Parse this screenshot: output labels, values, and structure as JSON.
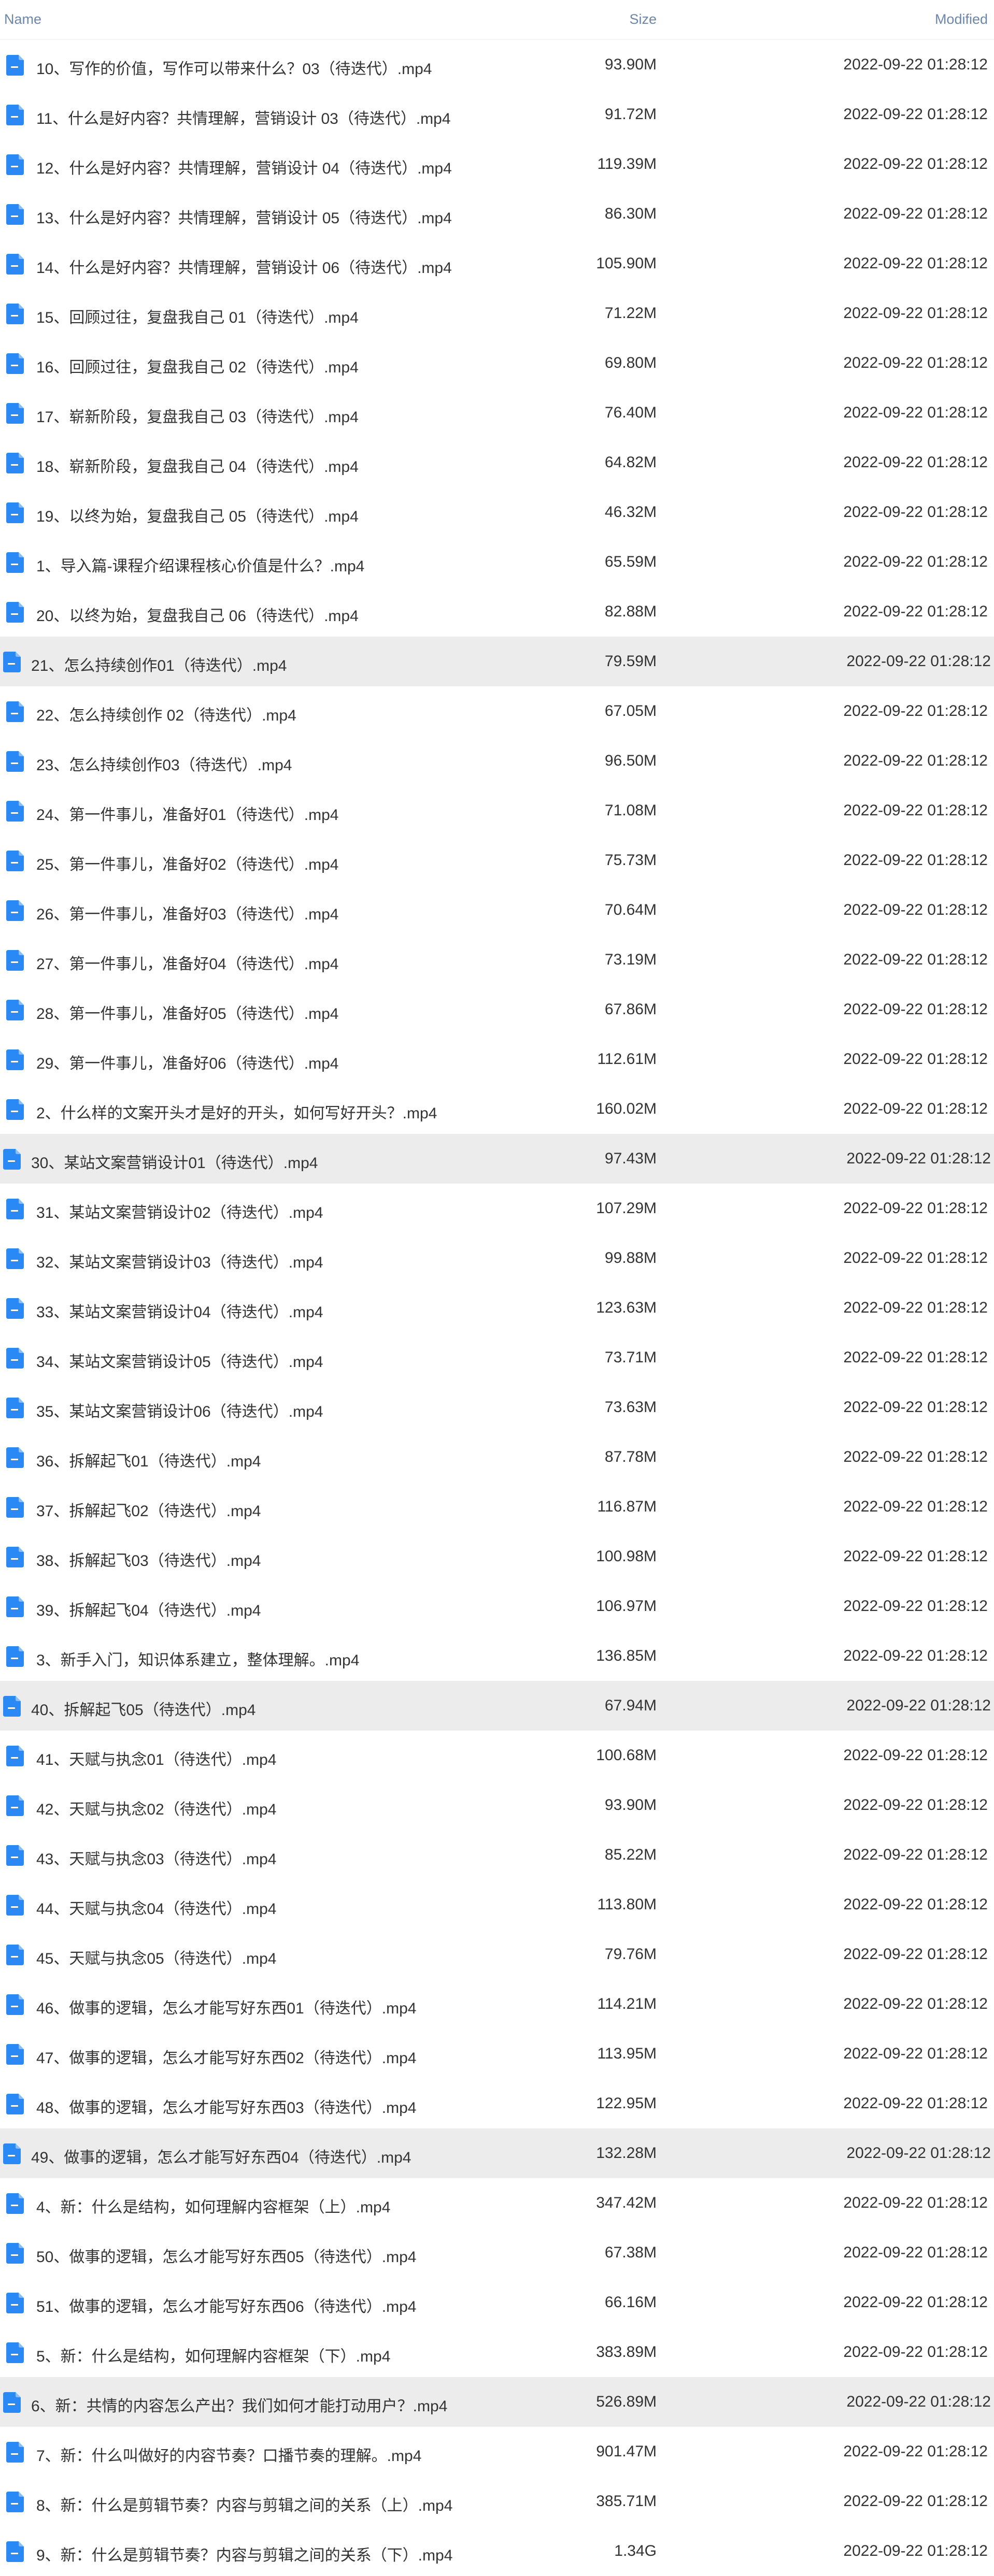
{
  "colors": {
    "accent": "#2a89f4",
    "header_text": "#6e87a8",
    "row_text": "#333333",
    "highlight_row": "#ececec"
  },
  "header": {
    "name": "Name",
    "size": "Size",
    "modified": "Modified"
  },
  "files": [
    {
      "name": "10、写作的价值，写作可以带来什么？03（待迭代）.mp4",
      "size": "93.90M",
      "modified": "2022-09-22 01:28:12",
      "highlighted": false
    },
    {
      "name": "11、什么是好内容？共情理解，营销设计 03（待迭代）.mp4",
      "size": "91.72M",
      "modified": "2022-09-22 01:28:12",
      "highlighted": false
    },
    {
      "name": "12、什么是好内容？共情理解，营销设计 04（待迭代）.mp4",
      "size": "119.39M",
      "modified": "2022-09-22 01:28:12",
      "highlighted": false
    },
    {
      "name": "13、什么是好内容？共情理解，营销设计 05（待迭代）.mp4",
      "size": "86.30M",
      "modified": "2022-09-22 01:28:12",
      "highlighted": false
    },
    {
      "name": "14、什么是好内容？共情理解，营销设计 06（待迭代）.mp4",
      "size": "105.90M",
      "modified": "2022-09-22 01:28:12",
      "highlighted": false
    },
    {
      "name": "15、回顾过往，复盘我自己 01（待迭代）.mp4",
      "size": "71.22M",
      "modified": "2022-09-22 01:28:12",
      "highlighted": false
    },
    {
      "name": "16、回顾过往，复盘我自己 02（待迭代）.mp4",
      "size": "69.80M",
      "modified": "2022-09-22 01:28:12",
      "highlighted": false
    },
    {
      "name": "17、崭新阶段，复盘我自己 03（待迭代）.mp4",
      "size": "76.40M",
      "modified": "2022-09-22 01:28:12",
      "highlighted": false
    },
    {
      "name": "18、崭新阶段，复盘我自己 04（待迭代）.mp4",
      "size": "64.82M",
      "modified": "2022-09-22 01:28:12",
      "highlighted": false
    },
    {
      "name": "19、以终为始，复盘我自己 05（待迭代）.mp4",
      "size": "46.32M",
      "modified": "2022-09-22 01:28:12",
      "highlighted": false
    },
    {
      "name": "1、导入篇-课程介绍课程核心价值是什么？.mp4",
      "size": "65.59M",
      "modified": "2022-09-22 01:28:12",
      "highlighted": false
    },
    {
      "name": "20、以终为始，复盘我自己 06（待迭代）.mp4",
      "size": "82.88M",
      "modified": "2022-09-22 01:28:12",
      "highlighted": false
    },
    {
      "name": "21、怎么持续创作01（待迭代）.mp4",
      "size": "79.59M",
      "modified": "2022-09-22 01:28:12",
      "highlighted": true
    },
    {
      "name": "22、怎么持续创作 02（待迭代）.mp4",
      "size": "67.05M",
      "modified": "2022-09-22 01:28:12",
      "highlighted": false
    },
    {
      "name": "23、怎么持续创作03（待迭代）.mp4",
      "size": "96.50M",
      "modified": "2022-09-22 01:28:12",
      "highlighted": false
    },
    {
      "name": "24、第一件事儿，准备好01（待迭代）.mp4",
      "size": "71.08M",
      "modified": "2022-09-22 01:28:12",
      "highlighted": false
    },
    {
      "name": "25、第一件事儿，准备好02（待迭代）.mp4",
      "size": "75.73M",
      "modified": "2022-09-22 01:28:12",
      "highlighted": false
    },
    {
      "name": "26、第一件事儿，准备好03（待迭代）.mp4",
      "size": "70.64M",
      "modified": "2022-09-22 01:28:12",
      "highlighted": false
    },
    {
      "name": "27、第一件事儿，准备好04（待迭代）.mp4",
      "size": "73.19M",
      "modified": "2022-09-22 01:28:12",
      "highlighted": false
    },
    {
      "name": "28、第一件事儿，准备好05（待迭代）.mp4",
      "size": "67.86M",
      "modified": "2022-09-22 01:28:12",
      "highlighted": false
    },
    {
      "name": "29、第一件事儿，准备好06（待迭代）.mp4",
      "size": "112.61M",
      "modified": "2022-09-22 01:28:12",
      "highlighted": false
    },
    {
      "name": "2、什么样的文案开头才是好的开头，如何写好开头？.mp4",
      "size": "160.02M",
      "modified": "2022-09-22 01:28:12",
      "highlighted": false
    },
    {
      "name": "30、某站文案营销设计01（待迭代）.mp4",
      "size": "97.43M",
      "modified": "2022-09-22 01:28:12",
      "highlighted": true
    },
    {
      "name": "31、某站文案营销设计02（待迭代）.mp4",
      "size": "107.29M",
      "modified": "2022-09-22 01:28:12",
      "highlighted": false
    },
    {
      "name": "32、某站文案营销设计03（待迭代）.mp4",
      "size": "99.88M",
      "modified": "2022-09-22 01:28:12",
      "highlighted": false
    },
    {
      "name": "33、某站文案营销设计04（待迭代）.mp4",
      "size": "123.63M",
      "modified": "2022-09-22 01:28:12",
      "highlighted": false
    },
    {
      "name": "34、某站文案营销设计05（待迭代）.mp4",
      "size": "73.71M",
      "modified": "2022-09-22 01:28:12",
      "highlighted": false
    },
    {
      "name": "35、某站文案营销设计06（待迭代）.mp4",
      "size": "73.63M",
      "modified": "2022-09-22 01:28:12",
      "highlighted": false
    },
    {
      "name": "36、拆解起飞01（待迭代）.mp4",
      "size": "87.78M",
      "modified": "2022-09-22 01:28:12",
      "highlighted": false
    },
    {
      "name": "37、拆解起飞02（待迭代）.mp4",
      "size": "116.87M",
      "modified": "2022-09-22 01:28:12",
      "highlighted": false
    },
    {
      "name": "38、拆解起飞03（待迭代）.mp4",
      "size": "100.98M",
      "modified": "2022-09-22 01:28:12",
      "highlighted": false
    },
    {
      "name": "39、拆解起飞04（待迭代）.mp4",
      "size": "106.97M",
      "modified": "2022-09-22 01:28:12",
      "highlighted": false
    },
    {
      "name": "3、新手入门，知识体系建立，整体理解。.mp4",
      "size": "136.85M",
      "modified": "2022-09-22 01:28:12",
      "highlighted": false
    },
    {
      "name": "40、拆解起飞05（待迭代）.mp4",
      "size": "67.94M",
      "modified": "2022-09-22 01:28:12",
      "highlighted": true
    },
    {
      "name": "41、天赋与执念01（待迭代）.mp4",
      "size": "100.68M",
      "modified": "2022-09-22 01:28:12",
      "highlighted": false
    },
    {
      "name": "42、天赋与执念02（待迭代）.mp4",
      "size": "93.90M",
      "modified": "2022-09-22 01:28:12",
      "highlighted": false
    },
    {
      "name": "43、天赋与执念03（待迭代）.mp4",
      "size": "85.22M",
      "modified": "2022-09-22 01:28:12",
      "highlighted": false
    },
    {
      "name": "44、天赋与执念04（待迭代）.mp4",
      "size": "113.80M",
      "modified": "2022-09-22 01:28:12",
      "highlighted": false
    },
    {
      "name": "45、天赋与执念05（待迭代）.mp4",
      "size": "79.76M",
      "modified": "2022-09-22 01:28:12",
      "highlighted": false
    },
    {
      "name": "46、做事的逻辑，怎么才能写好东西01（待迭代）.mp4",
      "size": "114.21M",
      "modified": "2022-09-22 01:28:12",
      "highlighted": false
    },
    {
      "name": "47、做事的逻辑，怎么才能写好东西02（待迭代）.mp4",
      "size": "113.95M",
      "modified": "2022-09-22 01:28:12",
      "highlighted": false
    },
    {
      "name": "48、做事的逻辑，怎么才能写好东西03（待迭代）.mp4",
      "size": "122.95M",
      "modified": "2022-09-22 01:28:12",
      "highlighted": false
    },
    {
      "name": "49、做事的逻辑，怎么才能写好东西04（待迭代）.mp4",
      "size": "132.28M",
      "modified": "2022-09-22 01:28:12",
      "highlighted": true
    },
    {
      "name": "4、新：什么是结构，如何理解内容框架（上）.mp4",
      "size": "347.42M",
      "modified": "2022-09-22 01:28:12",
      "highlighted": false
    },
    {
      "name": "50、做事的逻辑，怎么才能写好东西05（待迭代）.mp4",
      "size": "67.38M",
      "modified": "2022-09-22 01:28:12",
      "highlighted": false
    },
    {
      "name": "51、做事的逻辑，怎么才能写好东西06（待迭代）.mp4",
      "size": "66.16M",
      "modified": "2022-09-22 01:28:12",
      "highlighted": false
    },
    {
      "name": "5、新：什么是结构，如何理解内容框架（下）.mp4",
      "size": "383.89M",
      "modified": "2022-09-22 01:28:12",
      "highlighted": false
    },
    {
      "name": "6、新：共情的内容怎么产出？我们如何才能打动用户？.mp4",
      "size": "526.89M",
      "modified": "2022-09-22 01:28:12",
      "highlighted": true
    },
    {
      "name": "7、新：什么叫做好的内容节奏？口播节奏的理解。.mp4",
      "size": "901.47M",
      "modified": "2022-09-22 01:28:12",
      "highlighted": false
    },
    {
      "name": "8、新：什么是剪辑节奏？内容与剪辑之间的关系（上）.mp4",
      "size": "385.71M",
      "modified": "2022-09-22 01:28:12",
      "highlighted": false
    },
    {
      "name": "9、新：什么是剪辑节奏？内容与剪辑之间的关系（下）.mp4",
      "size": "1.34G",
      "modified": "2022-09-22 01:28:12",
      "highlighted": false
    }
  ]
}
